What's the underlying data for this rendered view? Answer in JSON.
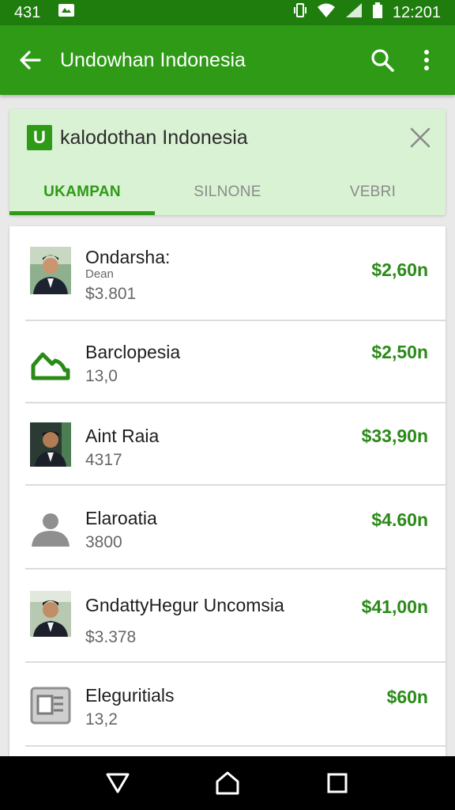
{
  "status_bar": {
    "time_left": "431",
    "clock": "12:201"
  },
  "app_bar": {
    "title": "Undowhan Indonesia"
  },
  "banner": {
    "logo_letter": "U",
    "title": "kalodothan Indonesia",
    "tabs": [
      {
        "label": "UKAMPAN",
        "active": true
      },
      {
        "label": "SILNONE",
        "active": false
      },
      {
        "label": "VEBRI",
        "active": false
      }
    ]
  },
  "list": {
    "rows": [
      {
        "name": "Ondarsha:",
        "sub1": "Dean",
        "sub2": "$3.801",
        "price": "$2,60n",
        "thumb": "person-photo"
      },
      {
        "name": "Barclopesia",
        "sub1": "",
        "sub2": "13,0",
        "price": "$2,50n",
        "thumb": "cloud-outline-icon"
      },
      {
        "name": "Aint Raia",
        "sub1": "",
        "sub2": "4317",
        "price": "$33,90n",
        "thumb": "person-photo"
      },
      {
        "name": "Elaroatia",
        "sub1": "",
        "sub2": "3800",
        "price": "$4.60n",
        "thumb": "person-placeholder-icon"
      },
      {
        "name": "GndattyHegur Uncomsia",
        "sub1": "",
        "sub2": "$3.378",
        "price": "$41,00n",
        "thumb": "person-photo"
      },
      {
        "name": "Eleguritials",
        "sub1": "",
        "sub2": "13,2",
        "price": "$60n",
        "thumb": "document-icon"
      }
    ]
  },
  "colors": {
    "status_bar": "#1f7d0e",
    "app_bar": "#2e9a16",
    "accent": "#2e9a16",
    "price": "#2a8a17"
  }
}
